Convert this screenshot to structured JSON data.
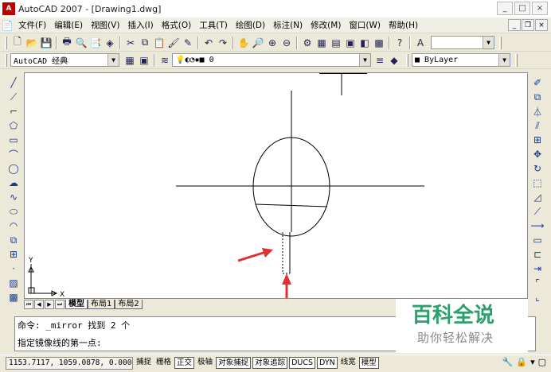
{
  "window": {
    "title": "AutoCAD 2007 - [Drawing1.dwg]",
    "controls": [
      "_",
      "□",
      "×"
    ]
  },
  "menu": [
    "文件(F)",
    "编辑(E)",
    "视图(V)",
    "插入(I)",
    "格式(O)",
    "工具(T)",
    "绘图(D)",
    "标注(N)",
    "修改(M)",
    "窗口(W)",
    "帮助(H)"
  ],
  "workspace": {
    "value": "AutoCAD 经典"
  },
  "layer": {
    "value": "0"
  },
  "color_control": {
    "value": "ByLayer"
  },
  "tabs": {
    "model": "模型",
    "layout1": "布局1",
    "layout2": "布局2"
  },
  "ucs": {
    "x": "X",
    "y": "Y"
  },
  "command": {
    "line1": "命令: _mirror 找到 2 个",
    "line2": "指定镜像线的第一点:"
  },
  "status": {
    "coords": "1153.7117, 1059.0878, 0.0000",
    "buttons": [
      "捕捉",
      "栅格",
      "正交",
      "极轴",
      "对象捕捉",
      "对象追踪",
      "DUCS",
      "DYN",
      "线宽",
      "模型"
    ]
  },
  "watermark": {
    "main": "百科全说",
    "sub": "助你轻松解决"
  },
  "colors": {
    "arrow": "#e03030",
    "watermark": "#2e9e6e"
  }
}
